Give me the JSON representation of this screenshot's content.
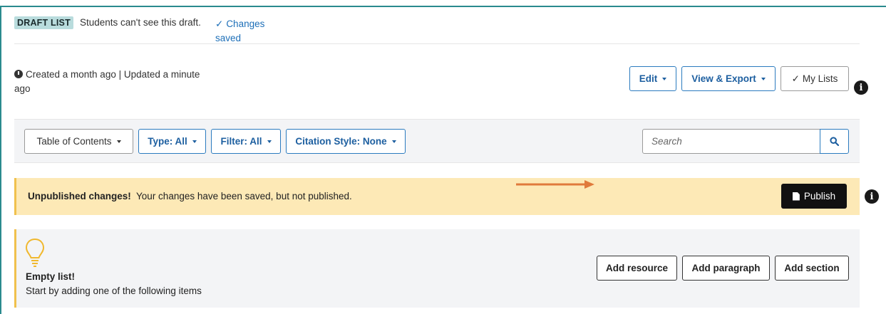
{
  "header": {
    "draft_badge": "DRAFT LIST",
    "draft_text": "Students can't see this draft.",
    "saved_check": "✓",
    "saved_line1": "Changes",
    "saved_line2": "saved"
  },
  "meta": {
    "created_text_line1": "Created a month ago | Updated a minute",
    "created_text_line2": "ago"
  },
  "actions": {
    "edit_label": "Edit",
    "view_export_label": "View & Export",
    "my_lists_check": "✓",
    "my_lists_label": "My Lists",
    "info_glyph": "i"
  },
  "toolbar": {
    "table_of_contents": "Table of Contents",
    "type": "Type: All",
    "filter": "Filter: All",
    "citation_style": "Citation Style: None",
    "search_placeholder": "Search"
  },
  "alert": {
    "title": "Unpublished changes!",
    "message": "Your changes have been saved, but not published.",
    "publish_label": "Publish",
    "info_glyph": "i"
  },
  "empty": {
    "title": "Empty list!",
    "subtitle": "Start by adding one of the following items",
    "add_resource": "Add resource",
    "add_paragraph": "Add paragraph",
    "add_section": "Add section"
  },
  "colors": {
    "accent_blue": "#1d5fa0",
    "frame_teal": "#2a8a8e",
    "badge_bg": "#b9dcdd",
    "alert_bg": "#fde9b6",
    "alert_border": "#f0c14d",
    "arrow_orange": "#e07a3c",
    "panel_gray": "#f3f4f6"
  },
  "icons": [
    "clock-icon",
    "check-icon",
    "caret-down-icon",
    "info-icon",
    "search-icon",
    "document-icon",
    "lightbulb-icon",
    "arrow-right-icon"
  ]
}
